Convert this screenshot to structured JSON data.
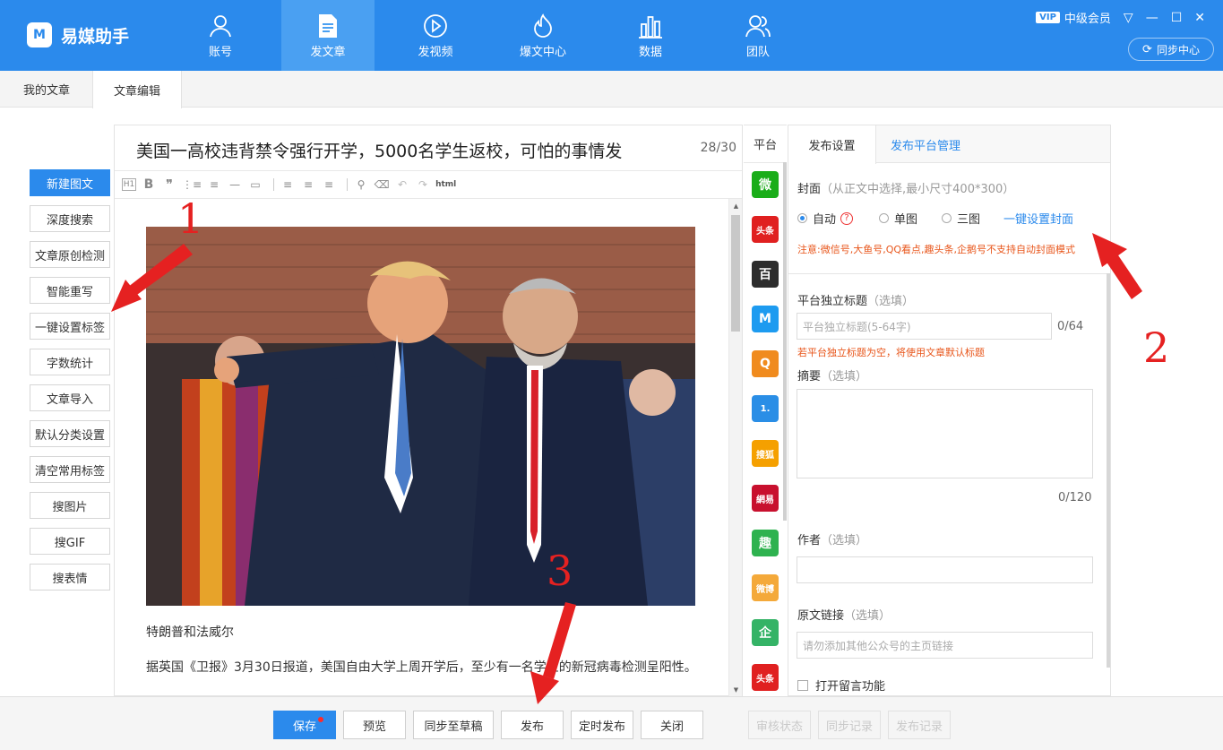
{
  "app": {
    "name": "易媒助手",
    "logo_mark": "M",
    "vip_badge": "VIP",
    "member_level": "中级会员",
    "sync_center": "同步中心"
  },
  "nav": [
    {
      "label": "账号",
      "icon": "user-icon"
    },
    {
      "label": "发文章",
      "icon": "document-icon",
      "active": true
    },
    {
      "label": "发视频",
      "icon": "play-icon"
    },
    {
      "label": "爆文中心",
      "icon": "fire-icon"
    },
    {
      "label": "数据",
      "icon": "bar-chart-icon"
    },
    {
      "label": "团队",
      "icon": "team-icon"
    }
  ],
  "window_controls": {
    "menu": "▽",
    "minimize": "—",
    "maximize": "☐",
    "close": "✕"
  },
  "tabs": [
    {
      "label": "我的文章"
    },
    {
      "label": "文章编辑",
      "active": true
    }
  ],
  "sidebar": [
    "新建图文",
    "深度搜索",
    "文章原创检测",
    "智能重写",
    "一键设置标签",
    "字数统计",
    "文章导入",
    "默认分类设置",
    "清空常用标签",
    "搜图片",
    "搜GIF",
    "搜表情"
  ],
  "editor": {
    "title": "美国一高校违背禁令强行开学，5000名学生返校，可怕的事情发",
    "title_count": "28/30",
    "toolbar": {
      "h1": "H1",
      "bold": "B",
      "quote": "❞",
      "ol": "⋮≡",
      "ul": "≡",
      "hr": "—",
      "image": "▭",
      "align_left": "≡",
      "align_center": "≡",
      "align_right": "≡",
      "find": "⚲",
      "clear": "⌫",
      "undo": "↶",
      "redo": "↷",
      "html": "html"
    },
    "image_alt": "photo-two-men-at-ceremony",
    "caption": "特朗普和法威尔",
    "paragraph": "据英国《卫报》3月30日报道，美国自由大学上周开学后，至少有一名学生的新冠病毒检测呈阳性。",
    "scroll_up": "▲",
    "scroll_down": "▼"
  },
  "platforms": {
    "header": "平台",
    "items": [
      {
        "name": "wechat",
        "label": "微",
        "color": "#1aad19"
      },
      {
        "name": "toutiao",
        "label": "头条",
        "color": "#e02020"
      },
      {
        "name": "baijiahao",
        "label": "百",
        "color": "#2d2d2d"
      },
      {
        "name": "dayu",
        "label": "M",
        "color": "#1d9bf0"
      },
      {
        "name": "qq-kandian",
        "label": "Q",
        "color": "#f08b1e"
      },
      {
        "name": "yidian",
        "label": "1.",
        "color": "#2a8ee6"
      },
      {
        "name": "sohu",
        "label": "搜狐",
        "color": "#f5a000"
      },
      {
        "name": "netease",
        "label": "網易",
        "color": "#c8102e"
      },
      {
        "name": "qutoutiao",
        "label": "趣",
        "color": "#2eb24f"
      },
      {
        "name": "weibo",
        "label": "微博",
        "color": "#f4a93a"
      },
      {
        "name": "qiehao",
        "label": "企",
        "color": "#34b366"
      },
      {
        "name": "toutiao-2",
        "label": "头条",
        "color": "#e02020"
      }
    ]
  },
  "settings": {
    "tab_publish": "发布设置",
    "tab_manage": "发布平台管理",
    "cover_label": "封面",
    "cover_hint": "（从正文中选择,最小尺寸400*300）",
    "cover_options": [
      "自动",
      "单图",
      "三图"
    ],
    "cover_help": "?",
    "cover_oneclick": "一键设置封面",
    "cover_notice": "注意:微信号,大鱼号,QQ看点,趣头条,企鹅号不支持自动封面模式",
    "independent_title_label": "平台独立标题",
    "independent_title_hint": "（选填）",
    "independent_title_placeholder": "平台独立标题(5-64字)",
    "independent_title_count": "0/64",
    "independent_title_notice": "若平台独立标题为空，将使用文章默认标题",
    "summary_label": "摘要",
    "summary_hint": "（选填）",
    "summary_count": "0/120",
    "author_label": "作者",
    "author_hint": "（选填）",
    "source_label": "原文链接",
    "source_hint": "（选填）",
    "source_placeholder": "请勿添加其他公众号的主页链接",
    "comments_label": "打开留言功能"
  },
  "bottom": {
    "save": "保存",
    "preview": "预览",
    "sync_draft": "同步至草稿",
    "publish": "发布",
    "schedule": "定时发布",
    "close": "关闭",
    "review_status": "审核状态",
    "sync_log": "同步记录",
    "publish_log": "发布记录"
  },
  "annotations": [
    "1",
    "2",
    "3"
  ],
  "colors": {
    "brand": "#2b8aec",
    "annotation_red": "#e52121",
    "notice_orange": "#e8561b"
  }
}
